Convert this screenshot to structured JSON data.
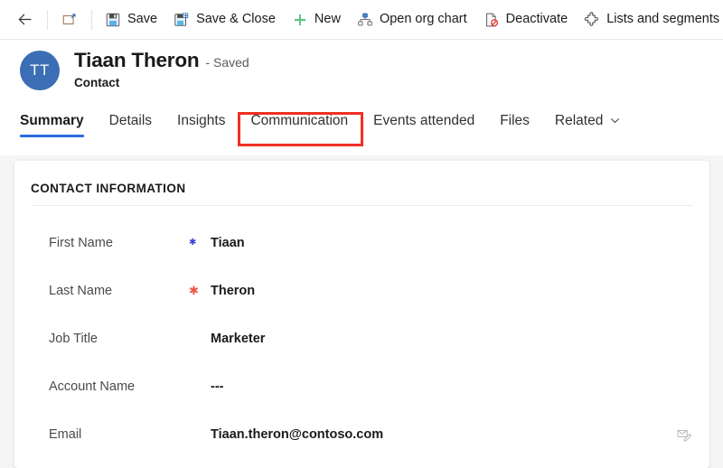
{
  "command_bar": {
    "buttons": [
      {
        "name": "back",
        "icon": "arrow-left-icon",
        "label": ""
      },
      {
        "name": "popout",
        "icon": "pop-out-icon",
        "label": ""
      },
      {
        "name": "save",
        "icon": "save-icon",
        "label": "Save"
      },
      {
        "name": "save-close",
        "icon": "save-close-icon",
        "label": "Save & Close"
      },
      {
        "name": "new",
        "icon": "plus-icon",
        "label": "New"
      },
      {
        "name": "open-org-chart",
        "icon": "org-chart-icon",
        "label": "Open org chart"
      },
      {
        "name": "deactivate",
        "icon": "deactivate-icon",
        "label": "Deactivate"
      },
      {
        "name": "lists-segments",
        "icon": "puzzle-icon",
        "label": "Lists and segments"
      }
    ]
  },
  "record": {
    "avatar_initials": "TT",
    "title": "Tiaan Theron",
    "state": "- Saved",
    "entity": "Contact"
  },
  "tabs": [
    {
      "label": "Summary",
      "active": true,
      "chevron": false
    },
    {
      "label": "Details",
      "active": false,
      "chevron": false
    },
    {
      "label": "Insights",
      "active": false,
      "chevron": false
    },
    {
      "label": "Communication",
      "active": false,
      "chevron": false
    },
    {
      "label": "Events attended",
      "active": false,
      "chevron": false
    },
    {
      "label": "Files",
      "active": false,
      "chevron": false
    },
    {
      "label": "Related",
      "active": false,
      "chevron": true
    }
  ],
  "form": {
    "section_title": "CONTACT INFORMATION",
    "fields": [
      {
        "label": "First Name",
        "required": "blue",
        "value": "Tiaan",
        "action_icon": ""
      },
      {
        "label": "Last Name",
        "required": "red",
        "value": "Theron",
        "action_icon": ""
      },
      {
        "label": "Job Title",
        "required": "",
        "value": "Marketer",
        "action_icon": ""
      },
      {
        "label": "Account Name",
        "required": "",
        "value": "---",
        "action_icon": ""
      },
      {
        "label": "Email",
        "required": "",
        "value": "Tiaan.theron@contoso.com",
        "action_icon": "email-compose-icon"
      }
    ]
  },
  "annotation": {
    "target_tab": "Communication",
    "color": "#ef3124"
  },
  "colors": {
    "accent_blue": "#2b6fe0",
    "avatar_blue": "#3b6eb4",
    "required_red": "#e8544a",
    "required_blue": "#3b3bdb",
    "page_background": "#f5f5f5",
    "annotation_red": "#ef3124"
  }
}
